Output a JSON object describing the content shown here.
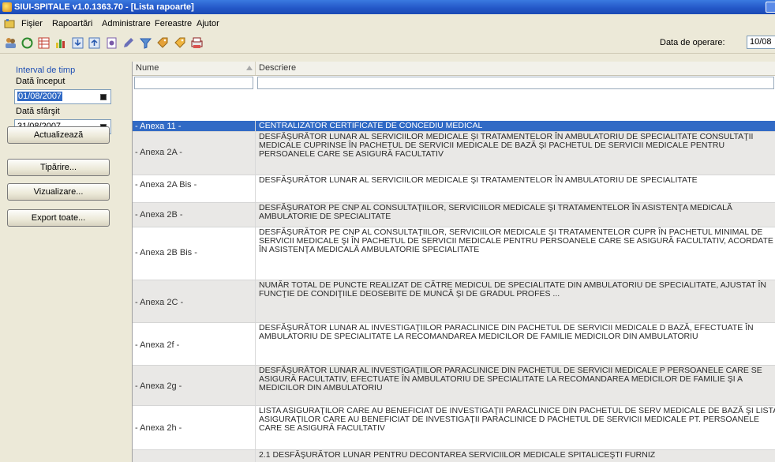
{
  "window": {
    "title": "SIUI-SPITALE v1.0.1363.70 - [Lista rapoarte]"
  },
  "menubar": {
    "items": [
      "Fişier",
      "Rapoartări",
      "Administrare",
      "Fereastre",
      "Ajutor"
    ]
  },
  "toolbar": {
    "icons": [
      "users-icon",
      "refresh-icon",
      "grid-icon",
      "chart-icon",
      "import-icon",
      "export-icon",
      "report-icon",
      "edit-icon",
      "filter-icon",
      "tag-icon",
      "tag2-icon",
      "print-icon"
    ],
    "operation_date_label": "Data de operare:",
    "operation_date_value": "10/08"
  },
  "leftpanel": {
    "group_title": "Interval de timp",
    "start_label": "Dată început",
    "start_value": "01/08/2007",
    "end_label": "Dată sfârşit",
    "end_value": "31/08/2007",
    "refresh_button": "Actualizează",
    "print_button": "Tipărire...",
    "preview_button": "Vizualizare...",
    "export_button": "Export toate..."
  },
  "grid": {
    "columns": [
      "Nume",
      "Descriere"
    ],
    "rows": [
      {
        "name": "- Anexa 11 -",
        "desc": "CENTRALIZATOR CERTIFICATE DE CONCEDIU MEDICAL"
      },
      {
        "name": "- Anexa 2A -",
        "desc": "DESFĂŞURĂTOR LUNAR AL SERVICIILOR MEDICALE ŞI TRATAMENTELOR ÎN AMBULATORIU DE SPECIALITATE CONSULTAŢII MEDICALE CUPRINSE ÎN PACHETUL DE SERVICII MEDICALE DE BAZĂ ŞI PACHETUL DE SERVICII MEDICALE PENTRU PERSOANELE CARE SE ASIGURĂ FACULTATIV"
      },
      {
        "name": "- Anexa 2A Bis -",
        "desc": "DESFĂŞURĂTOR LUNAR AL SERVICIILOR MEDICALE ŞI TRATAMENTELOR ÎN AMBULATORIU DE SPECIALITATE"
      },
      {
        "name": "- Anexa 2B -",
        "desc": "DESFĂŞURATOR PE CNP AL CONSULTAŢIILOR, SERVICIILOR MEDICALE ŞI TRATAMENTELOR ÎN ASISTENŢA MEDICALĂ AMBULATORIE DE SPECIALITATE"
      },
      {
        "name": "- Anexa 2B Bis -",
        "desc": "DESFĂŞURĂTOR PE CNP AL CONSULTAŢIILOR, SERVICIILOR MEDICALE ŞI TRATAMENTELOR CUPR ÎN PACHETUL MINIMAL DE SERVICII MEDICALE ŞI ÎN PACHETUL DE SERVICII MEDICALE PENTRU PERSOANELE CARE SE ASIGURĂ FACULTATIV, ACORDATE ÎN ASISTENŢA MEDICALĂ AMBULATORIE SPECIALITATE"
      },
      {
        "name": "- Anexa 2C -",
        "desc": "NUMĂR TOTAL DE PUNCTE REALIZAT DE CĂTRE MEDICUL DE SPECIALITATE DIN AMBULATORIU DE SPECIALITATE, AJUSTAT ÎN FUNCŢIE DE CONDIŢIILE DEOSEBITE DE MUNCĂ ŞI DE GRADUL PROFES ..."
      },
      {
        "name": "- Anexa 2f -",
        "desc": "DESFĂŞURĂTOR LUNAR AL INVESTIGAŢIILOR PARACLINICE DIN PACHETUL DE SERVICII MEDICALE D BAZĂ, EFECTUATE ÎN AMBULATORIU DE SPECIALITATE LA RECOMANDAREA MEDICILOR DE FAMILIE MEDICILOR DIN AMBULATORIU"
      },
      {
        "name": "- Anexa 2g -",
        "desc": "DESFĂŞURĂTOR LUNAR AL INVESTIGAŢIILOR PARACLINICE DIN PACHETUL DE SERVICII MEDICALE P PERSOANELE CARE SE ASIGURĂ FACULTATIV, EFECTUATE ÎN AMBULATORIU DE SPECIALITATE LA RECOMANDAREA MEDICILOR DE FAMILIE ŞI A MEDICILOR DIN AMBULATORIU"
      },
      {
        "name": "- Anexa 2h -",
        "desc": "LISTA ASIGURAŢILOR CARE AU BENEFICIAT DE INVESTIGAŢII PARACLINICE DIN PACHETUL DE SERV MEDICALE DE BAZĂ ŞI LISTA ASIGURAŢILOR CARE AU BENEFICIAT DE INVESTIGAŢII PARACLINICE D PACHETUL DE SERVICII MEDICALE PT. PERSOANELE CARE SE ASIGURĂ FACULTATIV"
      },
      {
        "name": "",
        "desc": "2.1 DESFĂŞURĂTOR LUNAR PENTRU DECONTAREA SERVICIILOR MEDICALE SPITALICEŞTI FURNIZ"
      }
    ]
  },
  "colors": {
    "title_blue": "#2458c8",
    "selection": "#316ac5",
    "group_title": "#1f4fb4"
  }
}
